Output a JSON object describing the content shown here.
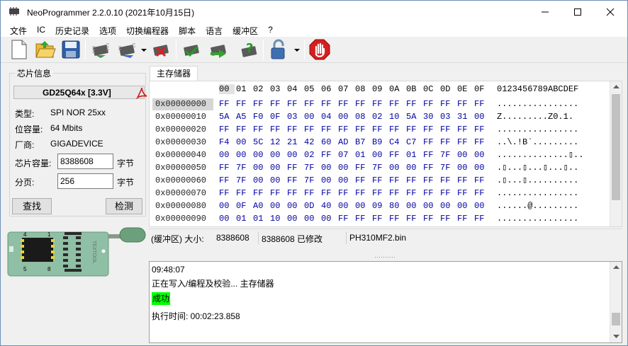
{
  "window": {
    "title": "NeoProgrammer 2.2.0.10 (2021年10月15日)"
  },
  "menu": [
    "文件",
    "IC",
    "历史记录",
    "选项",
    "切换编程器",
    "脚本",
    "语言",
    "缓冲区",
    "?"
  ],
  "chip_panel": {
    "group_label": "芯片信息",
    "chip_name": "GD25Q64x [3.3V]",
    "type_label": "类型:",
    "type_value": "SPI NOR 25xx",
    "size_label": "位容量:",
    "size_value": "64 Mbits",
    "vendor_label": "厂商:",
    "vendor_value": "GIGADEVICE",
    "capacity_label": "芯片容量:",
    "capacity_value": "8388608",
    "capacity_unit": "字节",
    "page_label": "分页:",
    "page_value": "256",
    "page_unit": "字节",
    "find_button": "查找",
    "detect_button": "检测",
    "socket_pin4": "4",
    "socket_pin1": "1",
    "socket_pin5": "5",
    "socket_pin8": "8",
    "socket_brand": "TEXTOOL"
  },
  "tab": {
    "label": "主存储器"
  },
  "hex": {
    "columns": [
      "00",
      "01",
      "02",
      "03",
      "04",
      "05",
      "06",
      "07",
      "08",
      "09",
      "0A",
      "0B",
      "0C",
      "0D",
      "0E",
      "0F"
    ],
    "ascii_header": "0123456789ABCDEF",
    "rows": [
      {
        "addr": "0x00000000",
        "bytes": [
          "FF",
          "FF",
          "FF",
          "FF",
          "FF",
          "FF",
          "FF",
          "FF",
          "FF",
          "FF",
          "FF",
          "FF",
          "FF",
          "FF",
          "FF",
          "FF"
        ],
        "ascii": "................"
      },
      {
        "addr": "0x00000010",
        "bytes": [
          "5A",
          "A5",
          "F0",
          "0F",
          "03",
          "00",
          "04",
          "00",
          "08",
          "02",
          "10",
          "5A",
          "30",
          "03",
          "31",
          "00"
        ],
        "ascii": "Z.........Z0.1."
      },
      {
        "addr": "0x00000020",
        "bytes": [
          "FF",
          "FF",
          "FF",
          "FF",
          "FF",
          "FF",
          "FF",
          "FF",
          "FF",
          "FF",
          "FF",
          "FF",
          "FF",
          "FF",
          "FF",
          "FF"
        ],
        "ascii": "................"
      },
      {
        "addr": "0x00000030",
        "bytes": [
          "F4",
          "00",
          "5C",
          "12",
          "21",
          "42",
          "60",
          "AD",
          "B7",
          "B9",
          "C4",
          "C7",
          "FF",
          "FF",
          "FF",
          "FF"
        ],
        "ascii": "..\\.!B`........."
      },
      {
        "addr": "0x00000040",
        "bytes": [
          "00",
          "00",
          "00",
          "00",
          "00",
          "02",
          "FF",
          "07",
          "01",
          "00",
          "FF",
          "01",
          "FF",
          "7F",
          "00",
          "00"
        ],
        "ascii": "..............▯.."
      },
      {
        "addr": "0x00000050",
        "bytes": [
          "FF",
          "7F",
          "00",
          "00",
          "FF",
          "7F",
          "00",
          "00",
          "FF",
          "7F",
          "00",
          "00",
          "FF",
          "7F",
          "00",
          "00"
        ],
        "ascii": ".▯...▯...▯...▯.."
      },
      {
        "addr": "0x00000060",
        "bytes": [
          "FF",
          "7F",
          "00",
          "00",
          "FF",
          "7F",
          "00",
          "00",
          "FF",
          "FF",
          "FF",
          "FF",
          "FF",
          "FF",
          "FF",
          "FF"
        ],
        "ascii": ".▯...▯.........."
      },
      {
        "addr": "0x00000070",
        "bytes": [
          "FF",
          "FF",
          "FF",
          "FF",
          "FF",
          "FF",
          "FF",
          "FF",
          "FF",
          "FF",
          "FF",
          "FF",
          "FF",
          "FF",
          "FF",
          "FF"
        ],
        "ascii": "................"
      },
      {
        "addr": "0x00000080",
        "bytes": [
          "00",
          "0F",
          "A0",
          "00",
          "00",
          "0D",
          "40",
          "00",
          "00",
          "09",
          "80",
          "00",
          "00",
          "00",
          "00",
          "00"
        ],
        "ascii": "......@........."
      },
      {
        "addr": "0x00000090",
        "bytes": [
          "00",
          "01",
          "01",
          "10",
          "00",
          "00",
          "00",
          "FF",
          "FF",
          "FF",
          "FF",
          "FF",
          "FF",
          "FF",
          "FF",
          "FF"
        ],
        "ascii": "................"
      }
    ]
  },
  "status": {
    "buffer_label": "(缓冲区) 大小:",
    "size": "8388608",
    "modified": "8388608 已修改",
    "filename": "PH310MF2.bin"
  },
  "log": {
    "time": "09:48:07",
    "action": "正在写入/编程及校验... 主存储器",
    "result": "成功",
    "elapsed": "执行时间:   00:02:23.858"
  },
  "colors": {
    "hex_value": "#0000a0",
    "success_bg": "#00ff00",
    "stop_red": "#d81e1e"
  }
}
